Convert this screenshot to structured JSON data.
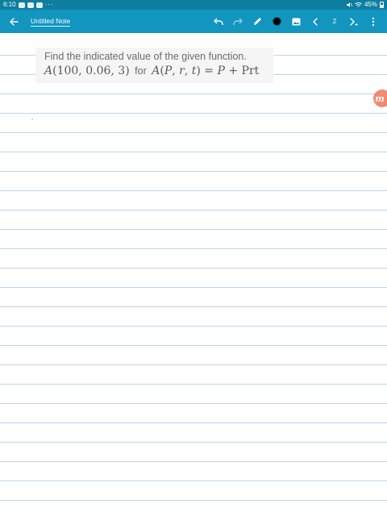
{
  "status_bar": {
    "time": "6:10",
    "more": "···",
    "battery": "45%"
  },
  "toolbar": {
    "note_title": "Untitled Note",
    "page_number": "2",
    "pen_color": "#000000",
    "accent": "#1295bf"
  },
  "question": {
    "prompt": "Find the indicated value of the given function.",
    "connector": "for"
  },
  "icons": {
    "back": "arrow-left-icon",
    "undo": "undo-icon",
    "redo": "redo-icon",
    "pen": "pencil-icon",
    "image": "image-icon",
    "prev_page": "chevron-left-icon",
    "next_page": "chevron-right-plus-icon",
    "menu": "more-vertical-icon",
    "badge": "app-logo-icon"
  }
}
